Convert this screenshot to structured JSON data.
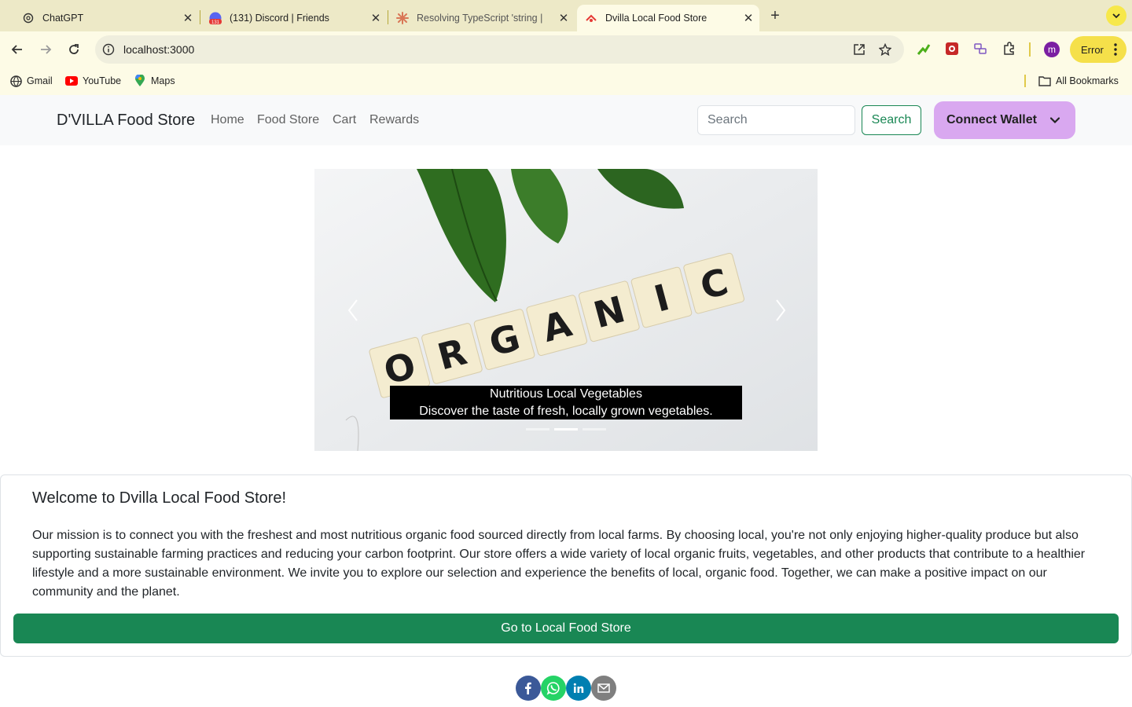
{
  "browser": {
    "tabs": [
      {
        "title": "ChatGPT",
        "icon": "chatgpt-icon"
      },
      {
        "title": "(131) Discord | Friends",
        "icon": "discord-icon",
        "badge": "131"
      },
      {
        "title": "Resolving TypeScript 'string |",
        "icon": "claude-icon"
      },
      {
        "title": "Dvilla Local Food Store",
        "icon": "react-icon",
        "active": true
      }
    ],
    "url": "localhost:3000",
    "avatar_initial": "m",
    "error_label": "Error",
    "bookmarks": [
      {
        "label": "Gmail",
        "icon": "gmail-icon"
      },
      {
        "label": "YouTube",
        "icon": "youtube-icon"
      },
      {
        "label": "Maps",
        "icon": "maps-icon"
      }
    ],
    "all_bookmarks": "All Bookmarks"
  },
  "site": {
    "brand": "D'VILLA Food Store",
    "nav": [
      "Home",
      "Food Store",
      "Cart",
      "Rewards"
    ],
    "search_placeholder": "Search",
    "search_button": "Search",
    "wallet_button": "Connect Wallet"
  },
  "carousel": {
    "image_text": "ORGANIC",
    "caption_title": "Nutritious Local Vegetables",
    "caption_text": "Discover the taste of fresh, locally grown vegetables.",
    "slide_count": 3,
    "active_index": 1
  },
  "welcome": {
    "title": "Welcome to Dvilla Local Food Store!",
    "body": "Our mission is to connect you with the freshest and most nutritious organic food sourced directly from local farms. By choosing local, you're not only enjoying higher-quality produce but also supporting sustainable farming practices and reducing your carbon footprint. Our store offers a wide variety of local organic fruits, vegetables, and other products that contribute to a healthier lifestyle and a more sustainable environment. We invite you to explore our selection and experience the benefits of local, organic food. Together, we can make a positive impact on our community and the planet.",
    "button": "Go to Local Food Store"
  },
  "share": [
    {
      "icon": "facebook-icon",
      "color": "#3b5998"
    },
    {
      "icon": "whatsapp-icon",
      "color": "#25d366"
    },
    {
      "icon": "linkedin-icon",
      "color": "#007fb1"
    },
    {
      "icon": "email-icon",
      "color": "#7f7f7f"
    }
  ]
}
